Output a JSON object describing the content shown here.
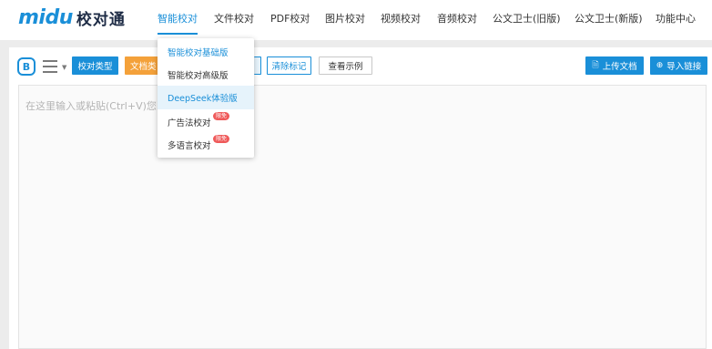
{
  "logo": {
    "en": "midu",
    "cn": "校对通"
  },
  "nav": {
    "items": [
      {
        "label": "智能校对",
        "active": true
      },
      {
        "label": "文件校对"
      },
      {
        "label": "PDF校对"
      },
      {
        "label": "图片校对"
      },
      {
        "label": "视频校对"
      },
      {
        "label": "音频校对"
      },
      {
        "label": "公文卫士(旧版)"
      },
      {
        "label": "公文卫士(新版)"
      },
      {
        "label": "功能中心"
      }
    ]
  },
  "toolbar": {
    "b_icon": "B",
    "proof_type_label": "校对类型",
    "doc_type_label": "文档类",
    "clear_marks_label": "清除标记",
    "view_example_label": "查看示例",
    "upload_doc_label": "上传文档",
    "import_link_label": "导入链接"
  },
  "editor": {
    "placeholder": "在这里输入或粘贴(Ctrl+V)您"
  },
  "dropdown": {
    "items": [
      {
        "label": "智能校对基础版",
        "state": "selected"
      },
      {
        "label": "智能校对高级版"
      },
      {
        "label": "DeepSeek体验版",
        "state": "hover"
      },
      {
        "label": "广告法校对",
        "badge": "限免"
      },
      {
        "label": "多语言校对",
        "badge": "限免"
      }
    ]
  },
  "colors": {
    "accent": "#1a8fd8",
    "orange": "#f4a13a",
    "badge_red": "#ef5a5a",
    "page_bg": "#ececec"
  }
}
